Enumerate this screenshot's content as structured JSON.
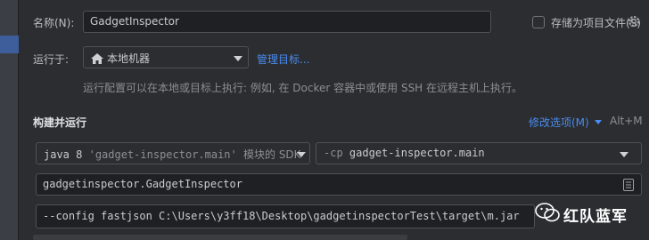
{
  "name_field": {
    "label": "名称(N):",
    "value": "GadgetInspector"
  },
  "store_as_project_file": {
    "label": "存储为项目文件(S)"
  },
  "run_on": {
    "label": "运行于:",
    "selected": "本地机器",
    "manage_link": "管理目标..."
  },
  "run_hint": "运行配置可以在本地或目标上执行: 例如, 在 Docker 容器中或使用 SSH 在远程主机上执行。",
  "build_run": {
    "title": "构建并运行",
    "modify_options": "修改选项(M)",
    "shortcut": "Alt+M",
    "jre": {
      "prefix": "java 8",
      "module_quoted": "'gadget-inspector.main'",
      "suffix": "模块的 SDK"
    },
    "classpath": {
      "flag": "-cp",
      "value": "gadget-inspector.main"
    },
    "main_class": "gadgetinspector.GadgetInspector",
    "program_args": "--config fastjson C:\\Users\\y3ff18\\Desktop\\gadgetinspectorTest\\target\\m.jar"
  },
  "watermark": {
    "text": "红队蓝军"
  },
  "colors": {
    "background": "#2b2d30",
    "input_bg": "#1f2023",
    "link": "#4a8cf0",
    "selection": "#3d5e9a"
  }
}
